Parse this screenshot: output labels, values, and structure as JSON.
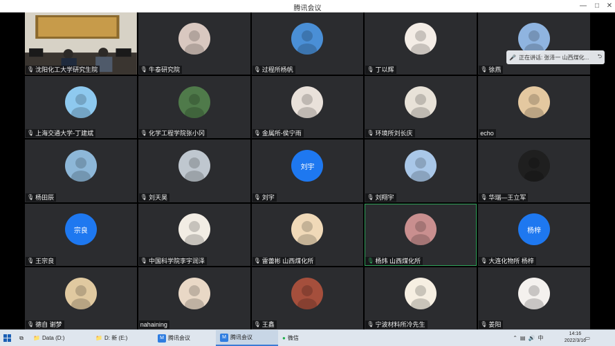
{
  "window": {
    "title": "腾讯会议"
  },
  "toast": {
    "text": "正在讲话: 张泽一 山西煤化..."
  },
  "participants": [
    {
      "name": "沈阳化工大学研究生院",
      "avatar": "video-conference-room"
    },
    {
      "name": "牛泰研究院",
      "avatar": "woman-photo"
    },
    {
      "name": "过程所杨帆",
      "avatar": "sunflower"
    },
    {
      "name": "丁以辉",
      "avatar": "bear"
    },
    {
      "name": "徐燕",
      "avatar": "sphere"
    },
    {
      "name": "上海交通大学-丁建斌",
      "avatar": "heart-tree"
    },
    {
      "name": "化学工程学院张小冈",
      "avatar": "garden"
    },
    {
      "name": "金属所-侯宁雨",
      "avatar": "boy"
    },
    {
      "name": "环境所刘长庆",
      "avatar": "sketch-girl"
    },
    {
      "name": "echo",
      "avatar": "dog"
    },
    {
      "name": "杨田辰",
      "avatar": "outdoor-man"
    },
    {
      "name": "刘天昊",
      "avatar": "two-people"
    },
    {
      "name": "刘宇",
      "avatar_text": "刘宇"
    },
    {
      "name": "刘翔宇",
      "avatar": "flower"
    },
    {
      "name": "华瑞—王立军",
      "avatar": "man-portrait"
    },
    {
      "name": "王宗良",
      "avatar_text": "宗良"
    },
    {
      "name": "中国科学院李宇润泽",
      "avatar": "cartoon-face"
    },
    {
      "name": "雷蕾彬 山西煤化所",
      "avatar": "tiger"
    },
    {
      "name": "杨炜 山西煤化所",
      "avatar": "girl-red"
    },
    {
      "name": "大连化物所 杨梓",
      "avatar_text": "杨梓"
    },
    {
      "name": "德自 谢梦",
      "avatar": "girl-field"
    },
    {
      "name": "nahaining",
      "avatar": "cat"
    },
    {
      "name": "王鑫",
      "avatar": "woman-red"
    },
    {
      "name": "宁波材料所冷先生",
      "avatar": "crayon-boy"
    },
    {
      "name": "姜阳",
      "avatar": "cartoon-bear"
    }
  ],
  "taskbar": {
    "apps": [
      {
        "label": "Data (D:)"
      },
      {
        "label": "D: 新 (E:)"
      },
      {
        "label": "腾讯会议"
      },
      {
        "label": "腾讯会议"
      },
      {
        "label": "微信"
      }
    ],
    "clock": {
      "time": "14:16",
      "date": "2022/3/16"
    },
    "lang": "中"
  }
}
